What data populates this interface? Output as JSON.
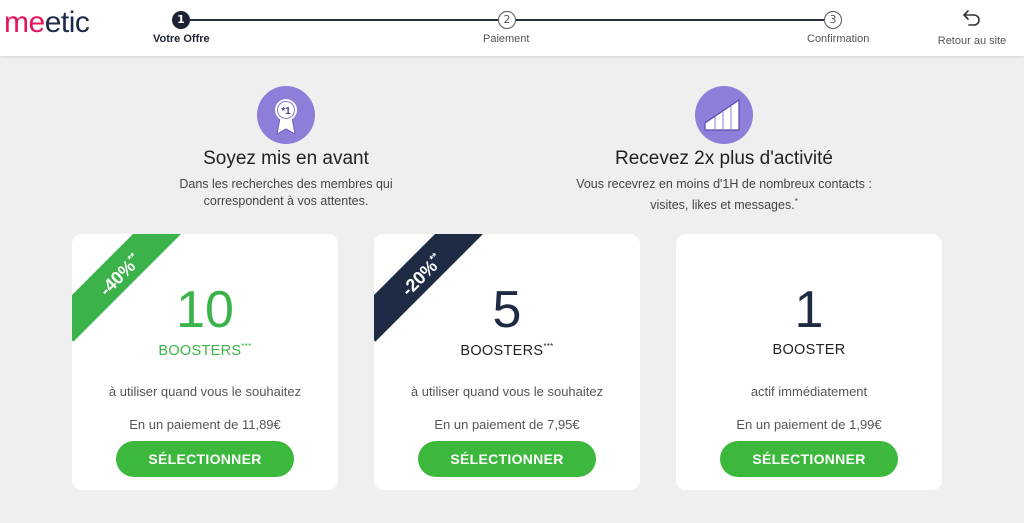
{
  "header": {
    "logo": {
      "prefix": "me",
      "rest": "etic"
    },
    "steps": [
      {
        "number": "1",
        "label": "Votre Offre",
        "active": true
      },
      {
        "number": "2",
        "label": "Paiement",
        "active": false
      },
      {
        "number": "3",
        "label": "Confirmation",
        "active": false
      }
    ],
    "back_label": "Retour au site"
  },
  "features": [
    {
      "icon": "medal-icon",
      "badge": "*1",
      "title": "Soyez mis en avant",
      "desc_line1": "Dans les recherches des membres qui",
      "desc_line2": "correspondent à vos attentes."
    },
    {
      "icon": "growth-chart-icon",
      "title": "Recevez 2x plus d'activité",
      "desc_line1": "Vous recevrez en moins d'1H de nombreux contacts :",
      "desc_line2": "visites, likes et messages.",
      "desc_mark": "*"
    }
  ],
  "cards": [
    {
      "ribbon": "-40%",
      "ribbon_mark": "**",
      "count": "10",
      "unit": "BOOSTERS",
      "unit_mark": "***",
      "usage": "à utiliser quand vous le souhaitez",
      "price": "En un paiement de 11,89€",
      "button": "SÉLECTIONNER"
    },
    {
      "ribbon": "-20%",
      "ribbon_mark": "**",
      "count": "5",
      "unit": "BOOSTERS",
      "unit_mark": "***",
      "usage": "à utiliser quand vous le souhaitez",
      "price": "En un paiement de 7,95€",
      "button": "SÉLECTIONNER"
    },
    {
      "count": "1",
      "unit": "BOOSTER",
      "usage": "actif immédiatement",
      "price": "En un paiement de 1,99€",
      "button": "SÉLECTIONNER"
    }
  ],
  "colors": {
    "brand_pink": "#e4145f",
    "brand_navy": "#1e2a4a",
    "accent_green": "#3bb34a",
    "icon_purple": "#8e7ed9"
  }
}
